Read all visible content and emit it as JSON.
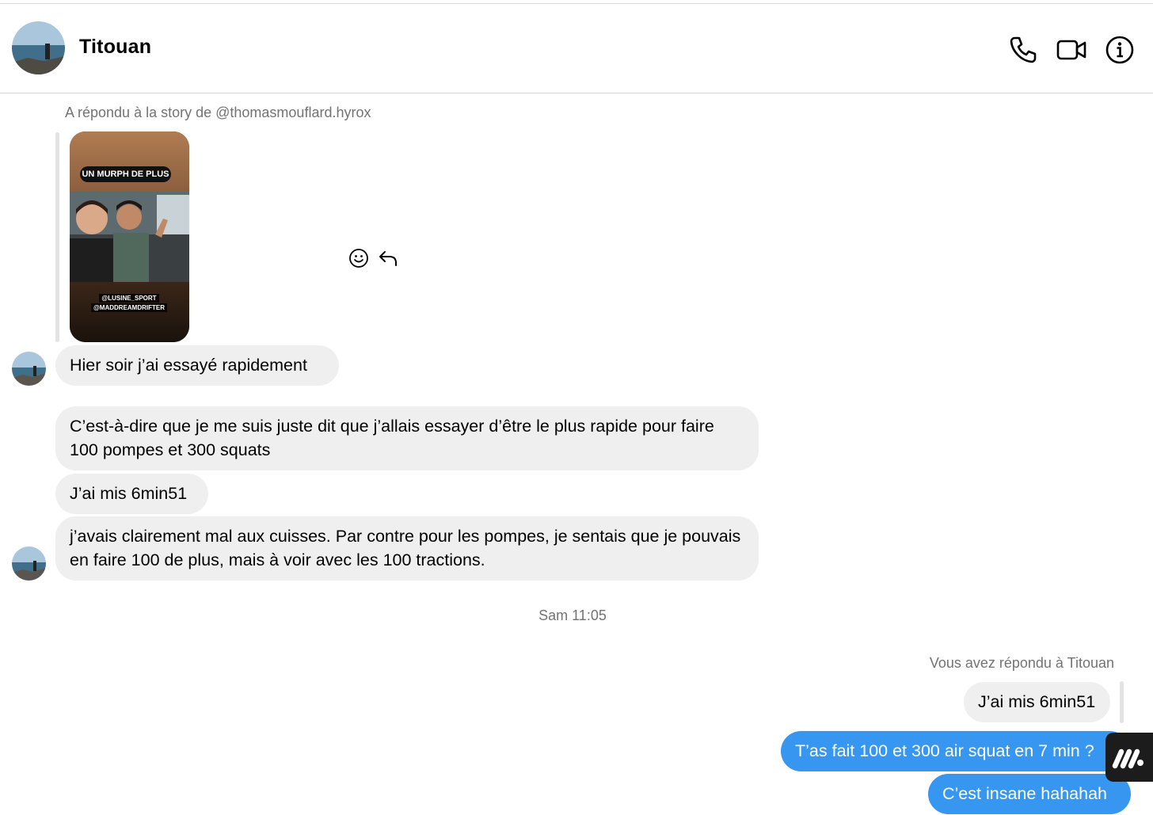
{
  "header": {
    "contact_name": "Titouan",
    "icons": [
      "phone-icon",
      "video-camera-icon",
      "info-icon"
    ]
  },
  "thread": {
    "story_reply": {
      "caption": "A répondu à la story de @thomasmouflard.hyrox",
      "story_title": "UN MURPH DE PLUS",
      "story_mentions": [
        "@LUSINE_SPORT",
        "@MADDREAMDRIFTER"
      ]
    },
    "actions": [
      "smiley-icon",
      "reply-icon"
    ],
    "incoming_messages": [
      "Hier soir j’ai essayé rapidement",
      "C’est-à-dire que je me suis juste dit que j’allais essayer d’être le plus rapide pour faire 100 pompes et 300 squats",
      "J’ai mis 6min51",
      "j’avais clairement mal aux cuisses. Par contre pour les pompes, je sentais que je pouvais en faire 100 de plus, mais à voir avec les 100 tractions."
    ],
    "timestamp": "Sam 11:05",
    "reply_caption": "Vous avez répondu à Titouan",
    "quoted_message": "J’ai mis 6min51",
    "outgoing_messages": [
      "T’as fait 100 et 300 air squat en 7 min ?",
      "C’est insane hahahah"
    ]
  },
  "colors": {
    "incoming_bubble": "#efefef",
    "outgoing_bubble": "#3797f0",
    "secondary_text": "#737373"
  },
  "floating_badge": "m-logo-icon"
}
